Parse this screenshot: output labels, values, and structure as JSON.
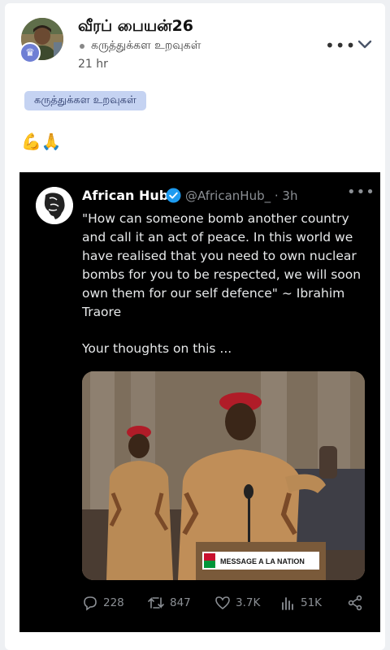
{
  "post": {
    "author": "வீரப் பையன்26",
    "group": "கருத்துக்கள உறவுகள்",
    "time": "21 hr",
    "tag": "கருத்துக்கள உறவுகள்",
    "emojis": "💪🙏",
    "more_icon": "more-horizontal-icon",
    "collapse_icon": "chevron-down-icon",
    "badge_icon": "crown-icon"
  },
  "tweet": {
    "name": "African Hub",
    "handle": "@AfricanHub_ · 3h",
    "text": "\"How can someone bomb another country and call it an act of peace. In this world we have realised that you need to own nuclear bombs for you to be respected, we will soon own them for our self defence\" ~ Ibrahim Traore",
    "question": "Your thoughts on this ...",
    "podium_sign": "MESSAGE A LA NATION",
    "stats": {
      "replies": "228",
      "retweets": "847",
      "likes": "3.7K",
      "views": "51K"
    }
  },
  "colors": {
    "tag_bg": "#c5d3f2",
    "tweet_bg": "#000000",
    "verified": "#1d9bf0",
    "beret": "#b0202c"
  }
}
